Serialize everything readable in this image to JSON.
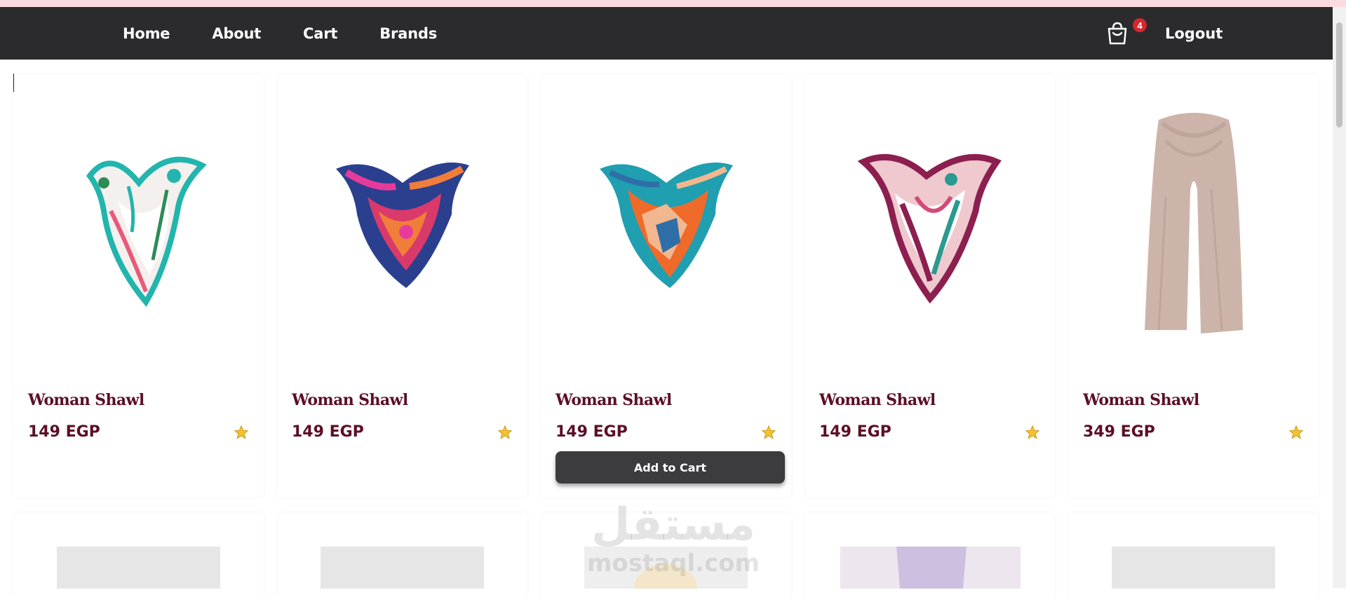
{
  "nav": {
    "links": [
      "Home",
      "About",
      "Cart",
      "Brands"
    ],
    "cart_count": "4",
    "logout_label": "Logout",
    "cart_icon": "shopping-bag-icon"
  },
  "products": [
    {
      "title": "Woman Shawl",
      "price": "149 EGP",
      "rating_icon": "star-icon",
      "palette": [
        "#21b5ad",
        "#f4f0ee",
        "#e85a7a",
        "#2e8b57"
      ]
    },
    {
      "title": "Woman Shawl",
      "price": "149 EGP",
      "rating_icon": "star-icon",
      "palette": [
        "#d93a6a",
        "#2b3f8f",
        "#f07e3a",
        "#e63b9a"
      ]
    },
    {
      "title": "Woman Shawl",
      "price": "149 EGP",
      "rating_icon": "star-icon",
      "palette": [
        "#1f9fb0",
        "#f06a2a",
        "#f2b78e",
        "#2e6fa8"
      ],
      "add_to_cart_label": "Add to Cart"
    },
    {
      "title": "Woman Shawl",
      "price": "149 EGP",
      "rating_icon": "star-icon",
      "palette": [
        "#8c1f4f",
        "#f0c9cf",
        "#2a9a90",
        "#d34a7a"
      ]
    },
    {
      "title": "Woman Shawl",
      "price": "349 EGP",
      "rating_icon": "star-icon",
      "palette": [
        "#cdb4aa",
        "#bfa59a"
      ]
    }
  ],
  "watermark": {
    "arabic": "مستقل",
    "latin": "mostaql.com"
  },
  "colors": {
    "navbar": "#2b2b2d",
    "accent_text": "#5c0f24",
    "badge": "#d6262d",
    "star": "#f2c230",
    "top_strip": "#fbd9df"
  }
}
